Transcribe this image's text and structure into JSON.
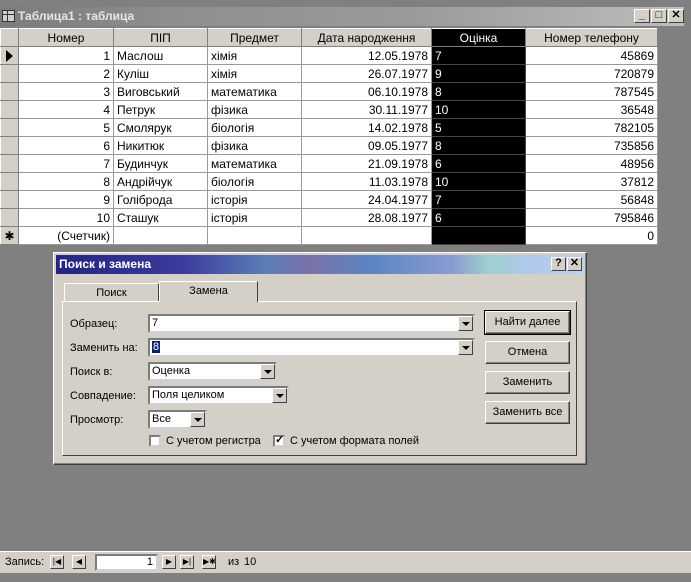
{
  "window": {
    "title": "Таблица1 : таблица",
    "min_label": "_",
    "max_label": "□",
    "close_label": "✕"
  },
  "table": {
    "columns": [
      "Номер",
      "ПІП",
      "Предмет",
      "Дата народження",
      "Оцінка",
      "Номер телефону"
    ],
    "rows": [
      [
        "1",
        "Маслош",
        "хімія",
        "12.05.1978",
        "7",
        "45869"
      ],
      [
        "2",
        "Куліш",
        "хімія",
        "26.07.1977",
        "9",
        "720879"
      ],
      [
        "3",
        "Виговський",
        "математика",
        "06.10.1978",
        "8",
        "787545"
      ],
      [
        "4",
        "Петрук",
        "фізика",
        "30.11.1977",
        "10",
        "36548"
      ],
      [
        "5",
        "Смолярук",
        "біологія",
        "14.02.1978",
        "5",
        "782105"
      ],
      [
        "6",
        "Никитюк",
        "фізика",
        "09.05.1977",
        "8",
        "735856"
      ],
      [
        "7",
        "Будинчук",
        "математика",
        "21.09.1978",
        "6",
        "48956"
      ],
      [
        "8",
        "Андрійчук",
        "біологія",
        "11.03.1978",
        "10",
        "37812"
      ],
      [
        "9",
        "Голіброда",
        "історія",
        "24.04.1977",
        "7",
        "56848"
      ],
      [
        "10",
        "Сташук",
        "історія",
        "28.08.1977",
        "6",
        "795846"
      ]
    ],
    "new_row": {
      "marker": "✱",
      "number": "(Счетчик)",
      "phone": "0"
    }
  },
  "dialog": {
    "title": "Поиск и замена",
    "help_label": "?",
    "close_label": "✕",
    "tabs": [
      "Поиск",
      "Замена"
    ],
    "active_tab": "Замена",
    "fields": {
      "find_label": "Образец:",
      "find_value": "7",
      "replace_label": "Заменить на:",
      "replace_value": "8",
      "look_in_label": "Поиск в:",
      "look_in_value": "Оценка",
      "match_label": "Совпадение:",
      "match_value": "Поля целиком",
      "search_label": "Просмотр:",
      "search_value": "Все"
    },
    "checkboxes": [
      {
        "label": "С учетом регистра",
        "checked": false
      },
      {
        "label": "С учетом формата полей",
        "checked": true
      }
    ],
    "buttons": {
      "find_next": "Найти далее",
      "cancel": "Отмена",
      "replace": "Заменить",
      "replace_all": "Заменить все"
    }
  },
  "status": {
    "record_label": "Запись:",
    "current_record": "1",
    "of_label": "из",
    "total": "10",
    "nav_icons": [
      "first-icon",
      "prev-icon",
      "next-icon",
      "last-icon",
      "new-record-icon"
    ]
  }
}
